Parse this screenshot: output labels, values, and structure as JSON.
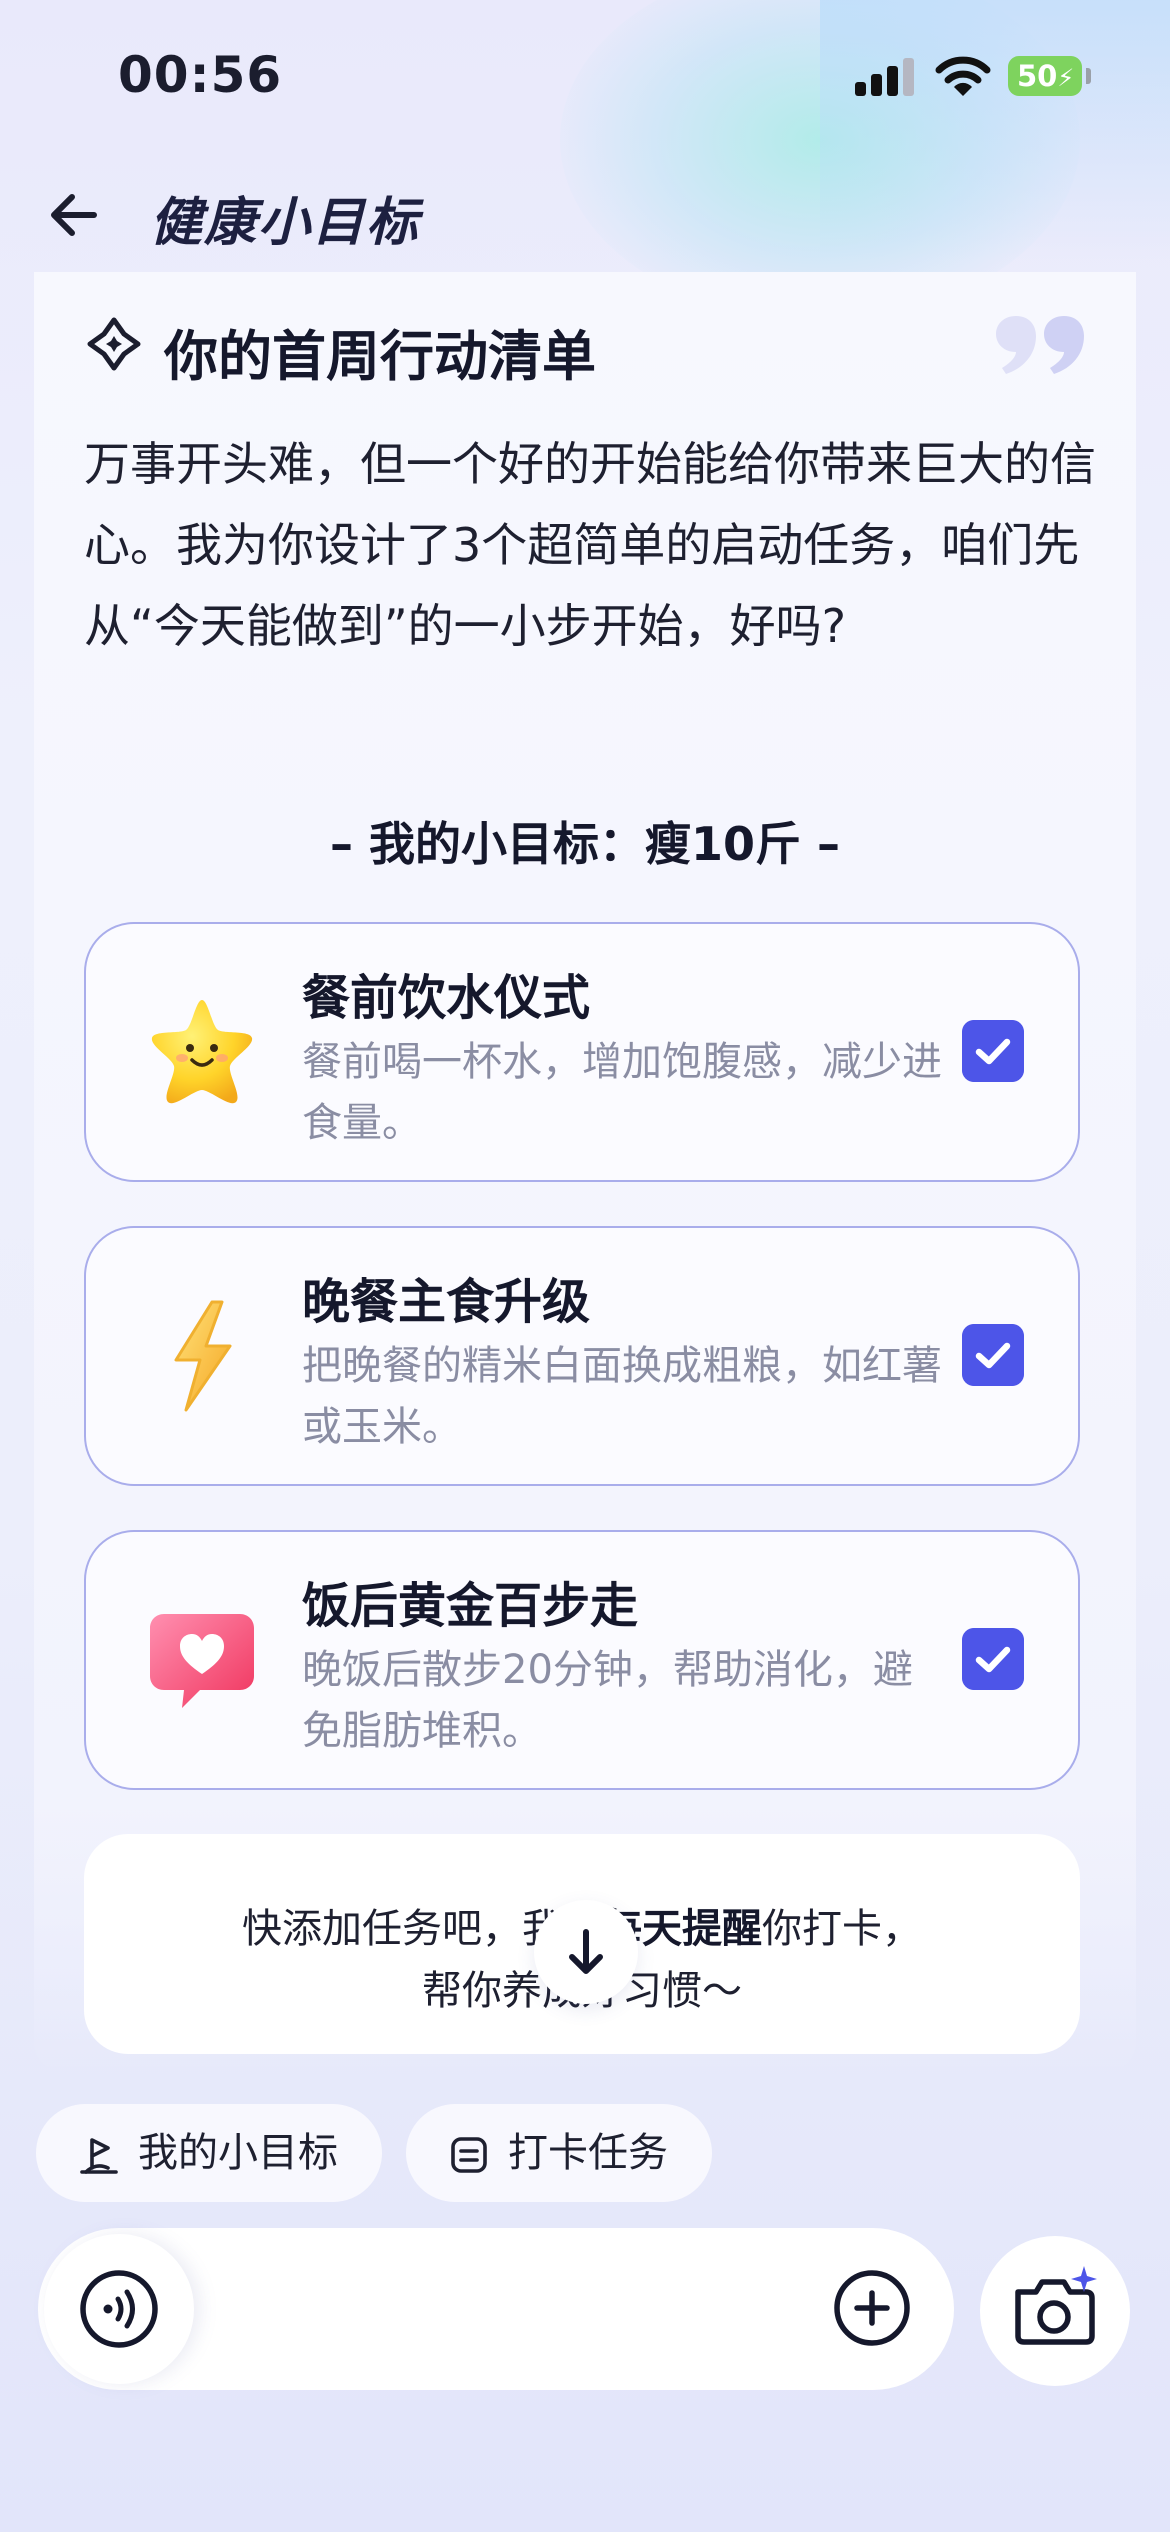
{
  "status_bar": {
    "time": "00:56",
    "battery": "50"
  },
  "header": {
    "title": "健康小目标",
    "back_icon": "arrow-left-icon"
  },
  "card": {
    "title": "你的首周行动清单",
    "intro": "万事开头难，但一个好的开始能给你带来巨大的信心。我为你设计了3个超简单的启动任务，咱们先从“今天能做到”的一小步开始，好吗?",
    "goal_line": "– 我的小目标：瘦10斤 –",
    "tasks": [
      {
        "title": "餐前饮水仪式",
        "desc": "餐前喝一杯水，增加饱腹感，减少进食量。",
        "icon": "star-emoji-icon",
        "checked": true
      },
      {
        "title": "晚餐主食升级",
        "desc": "把晚餐的精米白面换成粗粮，如红薯或玉米。",
        "icon": "lightning-emoji-icon",
        "checked": true
      },
      {
        "title": "饭后黄金百步走",
        "desc": "晚饭后散步20分钟，帮助消化，避免脂肪堆积。",
        "icon": "heart-bubble-emoji-icon",
        "checked": true
      }
    ],
    "tip": {
      "line1_a": "快添加任务吧，我将",
      "line1_bold": "每天提醒",
      "line1_b": "你打卡，",
      "line2": "帮你养成好习惯～"
    }
  },
  "bottom": {
    "chips": [
      {
        "label": "我的小目标",
        "icon": "flag-icon"
      },
      {
        "label": "打卡任务",
        "icon": "clipboard-icon"
      }
    ],
    "icons": [
      "voice-icon",
      "plus-circle-icon",
      "camera-icon",
      "arrow-down-icon"
    ]
  },
  "colors": {
    "accent": "#4d55e8",
    "card_border": "#a9adeb",
    "battery": "#7ed35e"
  }
}
